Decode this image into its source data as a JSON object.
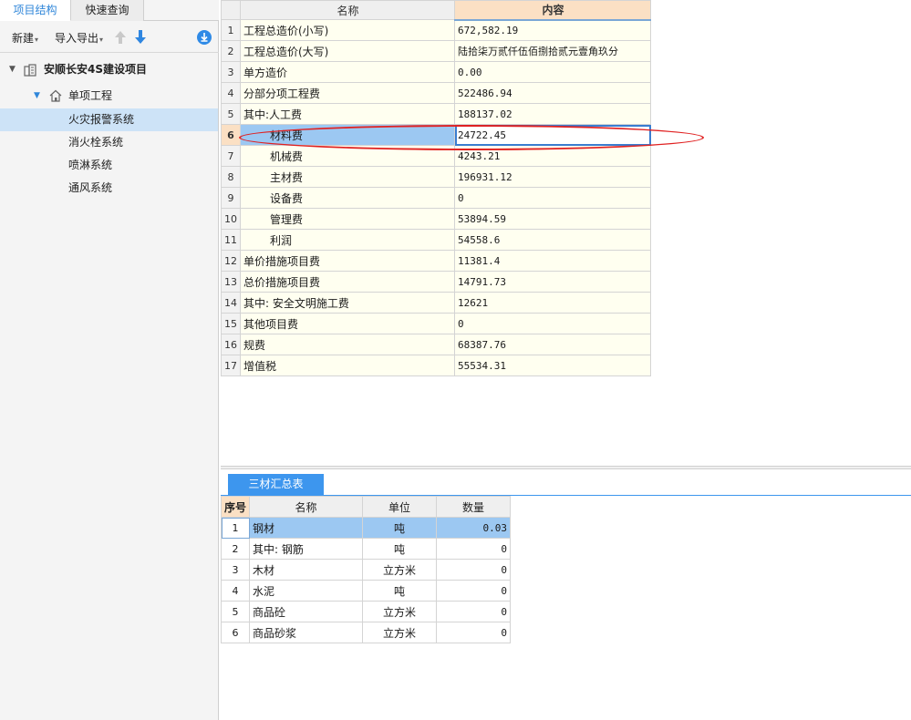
{
  "left_panel": {
    "tabs": [
      "项目结构",
      "快速查询"
    ],
    "toolbar": {
      "new_label": "新建",
      "import_export_label": "导入导出"
    },
    "tree": {
      "project": "安顺长安4S建设项目",
      "unit": "单项工程",
      "items": [
        "火灾报警系统",
        "消火栓系统",
        "喷淋系统",
        "通风系统"
      ],
      "selected": "火灾报警系统"
    }
  },
  "summary_grid": {
    "headers": {
      "name": "名称",
      "content": "内容"
    },
    "rows": [
      {
        "idx": "1",
        "name": "工程总造价(小写)",
        "value": "672,582.19"
      },
      {
        "idx": "2",
        "name": "工程总造价(大写)",
        "value": "陆拾柒万贰仟伍佰捌拾贰元壹角玖分"
      },
      {
        "idx": "3",
        "name": "单方造价",
        "value": "0.00"
      },
      {
        "idx": "4",
        "name": "分部分项工程费",
        "value": "522486.94"
      },
      {
        "idx": "5",
        "name": "其中:人工费",
        "value": "188137.02"
      },
      {
        "idx": "6",
        "name": "材料费",
        "value": "24722.45"
      },
      {
        "idx": "7",
        "name": "机械费",
        "value": "4243.21"
      },
      {
        "idx": "8",
        "name": "主材费",
        "value": "196931.12"
      },
      {
        "idx": "9",
        "name": "设备费",
        "value": "0"
      },
      {
        "idx": "10",
        "name": "管理费",
        "value": "53894.59"
      },
      {
        "idx": "11",
        "name": "利润",
        "value": "54558.6"
      },
      {
        "idx": "12",
        "name": "单价措施项目费",
        "value": "11381.4"
      },
      {
        "idx": "13",
        "name": "总价措施项目费",
        "value": "14791.73"
      },
      {
        "idx": "14",
        "name": "其中: 安全文明施工费",
        "value": "12621"
      },
      {
        "idx": "15",
        "name": "其他项目费",
        "value": "0"
      },
      {
        "idx": "16",
        "name": "规费",
        "value": "68387.76"
      },
      {
        "idx": "17",
        "name": "增值税",
        "value": "55534.31"
      }
    ],
    "selected_row": "6"
  },
  "materials": {
    "tab_label": "三材汇总表",
    "headers": {
      "seq": "序号",
      "name": "名称",
      "unit": "单位",
      "qty": "数量"
    },
    "rows": [
      {
        "idx": "1",
        "name": "钢材",
        "unit": "吨",
        "qty": "0.03"
      },
      {
        "idx": "2",
        "name": "其中: 钢筋",
        "unit": "吨",
        "qty": "0"
      },
      {
        "idx": "3",
        "name": "木材",
        "unit": "立方米",
        "qty": "0"
      },
      {
        "idx": "4",
        "name": "水泥",
        "unit": "吨",
        "qty": "0"
      },
      {
        "idx": "5",
        "name": "商品砼",
        "unit": "立方米",
        "qty": "0"
      },
      {
        "idx": "6",
        "name": "商品砂浆",
        "unit": "立方米",
        "qty": "0"
      }
    ],
    "selected_row": "1"
  },
  "colors": {
    "accent": "#3d96ee",
    "highlight": "#9cc8f2",
    "annotation": "#e02020"
  }
}
